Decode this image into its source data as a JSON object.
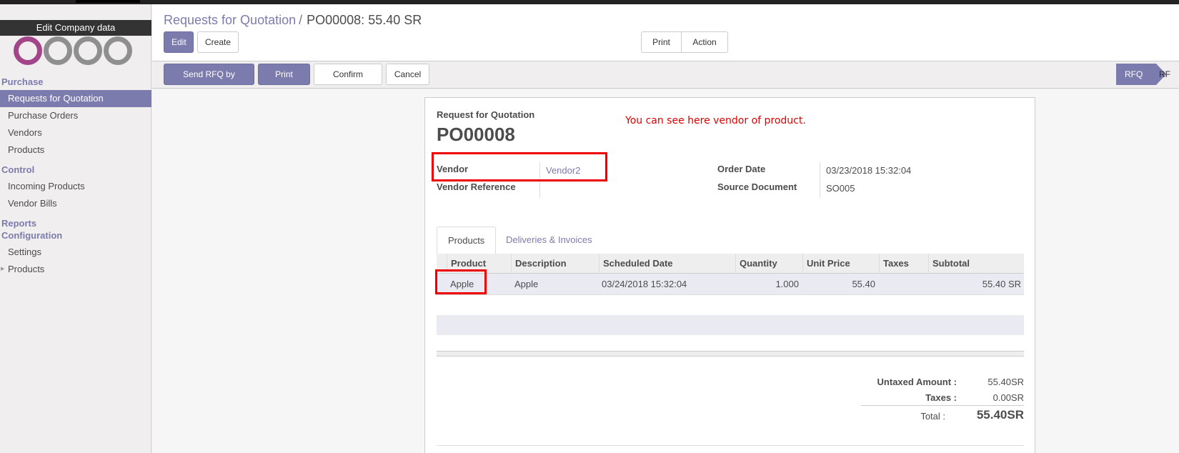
{
  "sidebar": {
    "edit_company": "Edit Company data",
    "sections": {
      "purchase": "Purchase",
      "control": "Control",
      "reports": "Reports",
      "configuration": "Configuration"
    },
    "items": {
      "rfq": "Requests for Quotation",
      "purchase_orders": "Purchase Orders",
      "vendors": "Vendors",
      "products": "Products",
      "incoming_products": "Incoming Products",
      "vendor_bills": "Vendor Bills",
      "settings": "Settings",
      "config_products": "Products"
    }
  },
  "breadcrumb": {
    "parent": "Requests for Quotation",
    "separator": "/",
    "current": "PO00008: 55.40 SR"
  },
  "toolbar": {
    "edit": "Edit",
    "create": "Create",
    "print": "Print",
    "action": "Action"
  },
  "statusbar": {
    "send_rfq_email": "Send RFQ by Email",
    "print_rfq": "Print RFQ",
    "confirm_order": "Confirm Order",
    "cancel": "Cancel",
    "stage_current": "RFQ",
    "stage_next": "RF"
  },
  "form": {
    "doc_label": "Request for Quotation",
    "doc_name": "PO00008",
    "annotation": "You can see here vendor of product.",
    "vendor_label": "Vendor",
    "vendor_value": "Vendor2",
    "vendor_ref_label": "Vendor Reference",
    "order_date_label": "Order Date",
    "order_date_value": "03/23/2018 15:32:04",
    "source_doc_label": "Source Document",
    "source_doc_value": "SO005"
  },
  "tabs": {
    "products": "Products",
    "deliveries": "Deliveries & Invoices"
  },
  "table": {
    "headers": {
      "product": "Product",
      "description": "Description",
      "scheduled_date": "Scheduled Date",
      "quantity": "Quantity",
      "unit_price": "Unit Price",
      "taxes": "Taxes",
      "subtotal": "Subtotal"
    },
    "row": {
      "product": "Apple",
      "description": "Apple",
      "scheduled_date": "03/24/2018 15:32:04",
      "quantity": "1.000",
      "unit_price": "55.40",
      "taxes": "",
      "subtotal": "55.40 SR"
    }
  },
  "totals": {
    "untaxed_label": "Untaxed Amount :",
    "untaxed_value": "55.40SR",
    "taxes_label": "Taxes :",
    "taxes_value": "0.00SR",
    "total_label": "Total :",
    "total_value": "55.40SR"
  },
  "colors": {
    "accent": "#7c7bad",
    "annotation_red": "#e00000"
  }
}
